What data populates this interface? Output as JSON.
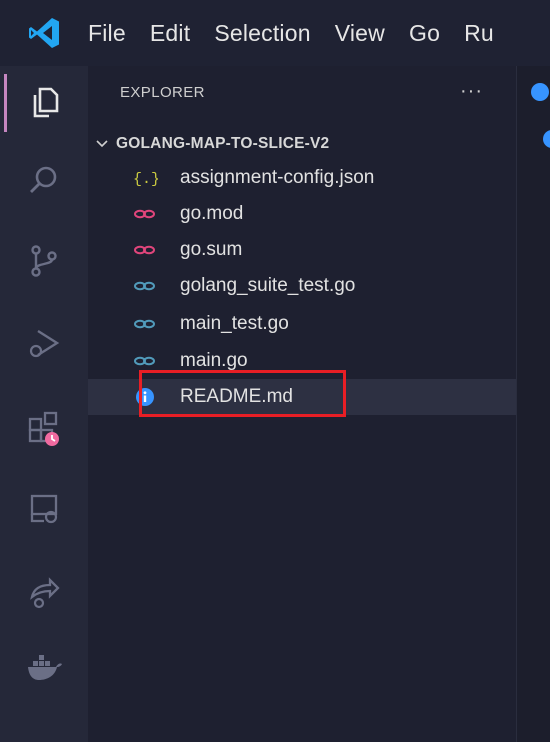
{
  "menu": {
    "items": [
      "File",
      "Edit",
      "Selection",
      "View",
      "Go",
      "Ru"
    ]
  },
  "activity_bar": {
    "icons": [
      "explorer-icon",
      "search-icon",
      "source-control-icon",
      "run-debug-icon",
      "extensions-icon",
      "remote-explorer-icon",
      "share-icon",
      "docker-icon"
    ],
    "active": "explorer-icon"
  },
  "explorer": {
    "header": "EXPLORER",
    "more": "···",
    "folder": "GOLANG-MAP-TO-SLICE-V2",
    "files": [
      {
        "name": "assignment-config.json",
        "icon": "json-icon",
        "color": "#cbcb41"
      },
      {
        "name": "go.mod",
        "icon": "go-mod-icon",
        "color": "#e0457b"
      },
      {
        "name": "go.sum",
        "icon": "go-sum-icon",
        "color": "#e0457b"
      },
      {
        "name": "golang_suite_test.go",
        "icon": "go-icon",
        "color": "#519aba"
      },
      {
        "name": "main_test.go",
        "icon": "go-icon",
        "color": "#519aba"
      },
      {
        "name": "main.go",
        "icon": "go-icon",
        "color": "#519aba"
      },
      {
        "name": "README.md",
        "icon": "info-icon",
        "color": "#3794ff"
      }
    ],
    "selected": "README.md"
  },
  "colors": {
    "accent": "#c586c0",
    "highlight": "#e81e25",
    "info": "#3794ff"
  }
}
